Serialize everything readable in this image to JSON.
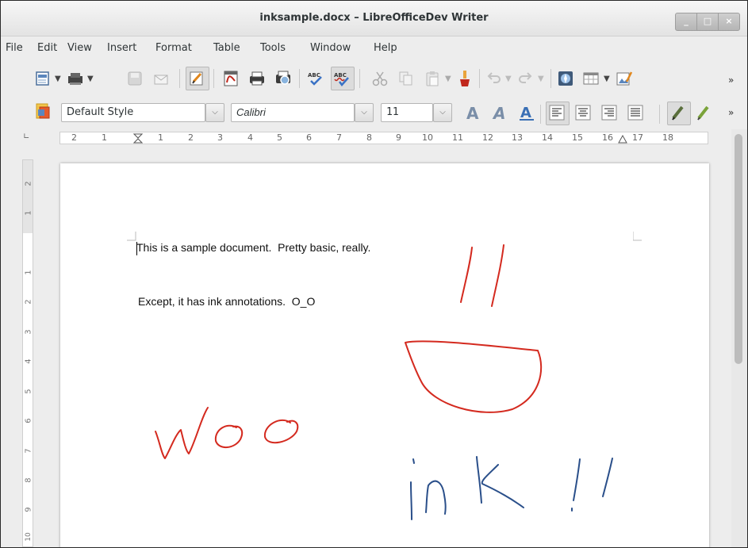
{
  "window": {
    "title": "inksample.docx – LibreOfficeDev Writer",
    "minimize_glyph": "_",
    "maximize_glyph": "□",
    "close_glyph": "×"
  },
  "menu": {
    "items": [
      "File",
      "Edit",
      "View",
      "Insert",
      "Format",
      "Table",
      "Tools",
      "Window",
      "Help"
    ]
  },
  "toolbar": {
    "overflow": "»",
    "icons": [
      "new-document-icon",
      "templates-icon",
      "save-icon",
      "email-icon",
      "edit-mode-icon",
      "export-pdf-icon",
      "print-icon",
      "print-preview-icon",
      "spellcheck-icon",
      "autospellcheck-icon",
      "cut-icon",
      "copy-icon",
      "paste-icon",
      "clone-formatting-icon",
      "undo-icon",
      "redo-icon",
      "navigator-icon",
      "table-icon",
      "image-icon"
    ]
  },
  "formatting": {
    "style_value": "Default Style",
    "font_value": "Calibri",
    "size_value": "11",
    "overflow": "»",
    "icons": [
      "styles-icon",
      "font-grow-icon",
      "font-italic-icon",
      "font-underline-icon",
      "align-left-icon",
      "align-center-icon",
      "align-right-icon",
      "justify-icon",
      "highlight-icon",
      "char-highlight-icon"
    ]
  },
  "ruler": {
    "h_labels": [
      "2",
      "1",
      "1",
      "2",
      "3",
      "4",
      "5",
      "6",
      "7",
      "8",
      "9",
      "10",
      "11",
      "12",
      "13",
      "14",
      "15",
      "16",
      "17",
      "18"
    ],
    "v_labels": [
      "2",
      "1",
      "1",
      "2",
      "3",
      "4",
      "5",
      "6",
      "7",
      "8",
      "9",
      "10"
    ]
  },
  "document": {
    "line1": "This is a sample document.  Pretty basic, really.",
    "line2": "Except, it has ink annotations.  O_O"
  },
  "ink": {
    "red": "#d42a1f",
    "blue": "#2a4f8a"
  }
}
